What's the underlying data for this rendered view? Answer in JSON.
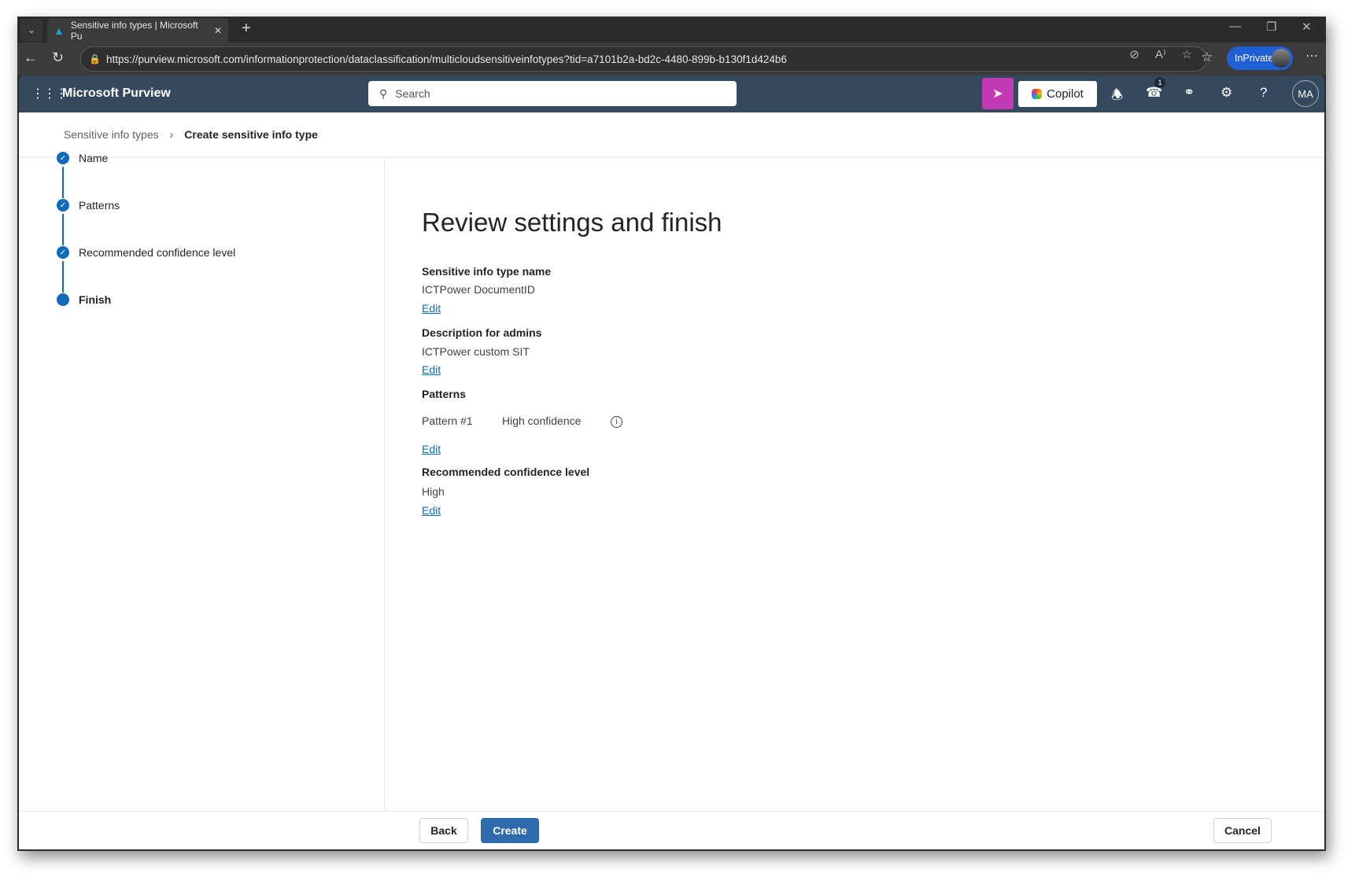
{
  "browser": {
    "tab_title": "Sensitive info types | Microsoft Pu",
    "url": "https://purview.microsoft.com/informationprotection/dataclassification/multicloudsensitiveinfotypes?tid=a7101b2a-bd2c-4480-899b-b130f1d424b6",
    "inprivate_label": "InPrivate"
  },
  "appbar": {
    "title": "Microsoft Purview",
    "search_placeholder": "Search",
    "copilot_label": "Copilot",
    "notification_count": "1",
    "avatar_initials": "MA"
  },
  "breadcrumb": {
    "parent": "Sensitive info types",
    "current": "Create sensitive info type"
  },
  "steps": [
    {
      "label": "Name",
      "status": "complete"
    },
    {
      "label": "Patterns",
      "status": "complete"
    },
    {
      "label": "Recommended confidence level",
      "status": "complete"
    },
    {
      "label": "Finish",
      "status": "current"
    }
  ],
  "review": {
    "title": "Review settings and finish",
    "name_label": "Sensitive info type name",
    "name_value": "ICTPower DocumentID",
    "desc_label": "Description for admins",
    "desc_value": "ICTPower custom SIT",
    "patterns_label": "Patterns",
    "pattern_name": "Pattern #1",
    "pattern_confidence": "High confidence",
    "confidence_label": "Recommended confidence level",
    "confidence_value": "High",
    "edit_label": "Edit"
  },
  "footer": {
    "back": "Back",
    "create": "Create",
    "cancel": "Cancel"
  },
  "colors": {
    "accent": "#0f6cbd",
    "appbar": "#34495e",
    "primary_button": "#2f6aad"
  }
}
